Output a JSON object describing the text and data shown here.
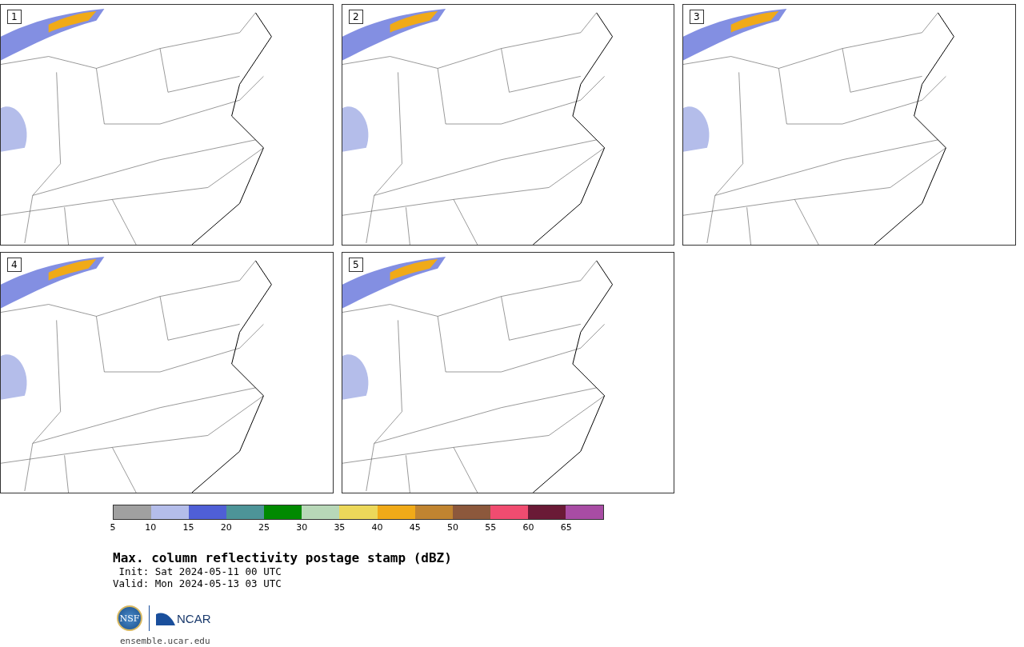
{
  "panels": [
    {
      "label": "1"
    },
    {
      "label": "2"
    },
    {
      "label": "3"
    },
    {
      "label": "4"
    },
    {
      "label": "5"
    }
  ],
  "colorbar": {
    "bins": [
      {
        "color": "#a0a0a0"
      },
      {
        "color": "#b4bdea"
      },
      {
        "color": "#4f5fd6"
      },
      {
        "color": "#4d9498"
      },
      {
        "color": "#008a00"
      },
      {
        "color": "#b8d8b8"
      },
      {
        "color": "#ecd85a"
      },
      {
        "color": "#f0aa18"
      },
      {
        "color": "#c08430"
      },
      {
        "color": "#8c583c"
      },
      {
        "color": "#f04c70"
      },
      {
        "color": "#6a1a36"
      },
      {
        "color": "#a84ca4"
      }
    ],
    "ticks": [
      "5",
      "10",
      "15",
      "20",
      "25",
      "30",
      "35",
      "40",
      "45",
      "50",
      "55",
      "60",
      "65"
    ]
  },
  "title": "Max. column reflectivity postage stamp (dBZ)",
  "init": " Init: Sat 2024-05-11 00 UTC",
  "valid": "Valid: Mon 2024-05-13 03 UTC",
  "logos": {
    "nsf": "NSF",
    "ncar": "NCAR"
  },
  "footer": "ensemble.ucar.edu"
}
